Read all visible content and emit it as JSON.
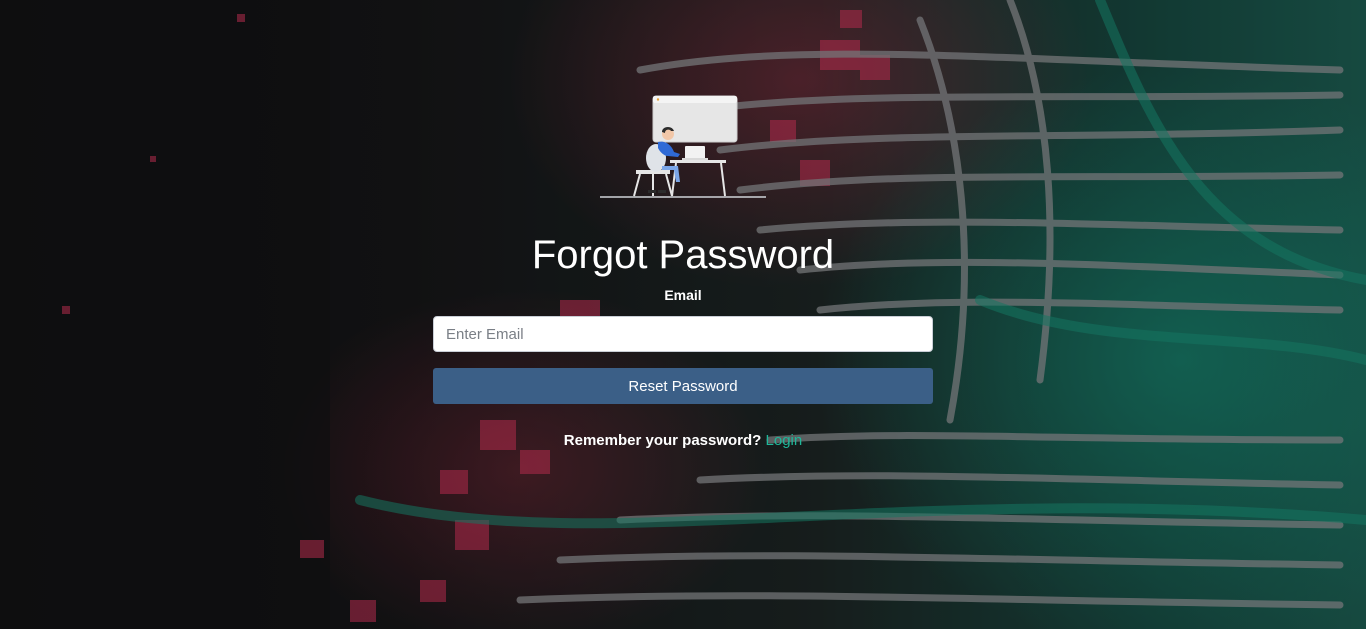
{
  "page": {
    "title": "Forgot Password",
    "email_label": "Email",
    "email_placeholder": "Enter Email",
    "email_value": "",
    "reset_button_label": "Reset Password",
    "remember_text": "Remember your password?",
    "login_link_label": "Login"
  },
  "colors": {
    "button_bg": "#3b5f87",
    "link": "#1fb79a",
    "text": "#ffffff"
  },
  "icons": {
    "illustration": "person-at-desk-illustration"
  }
}
